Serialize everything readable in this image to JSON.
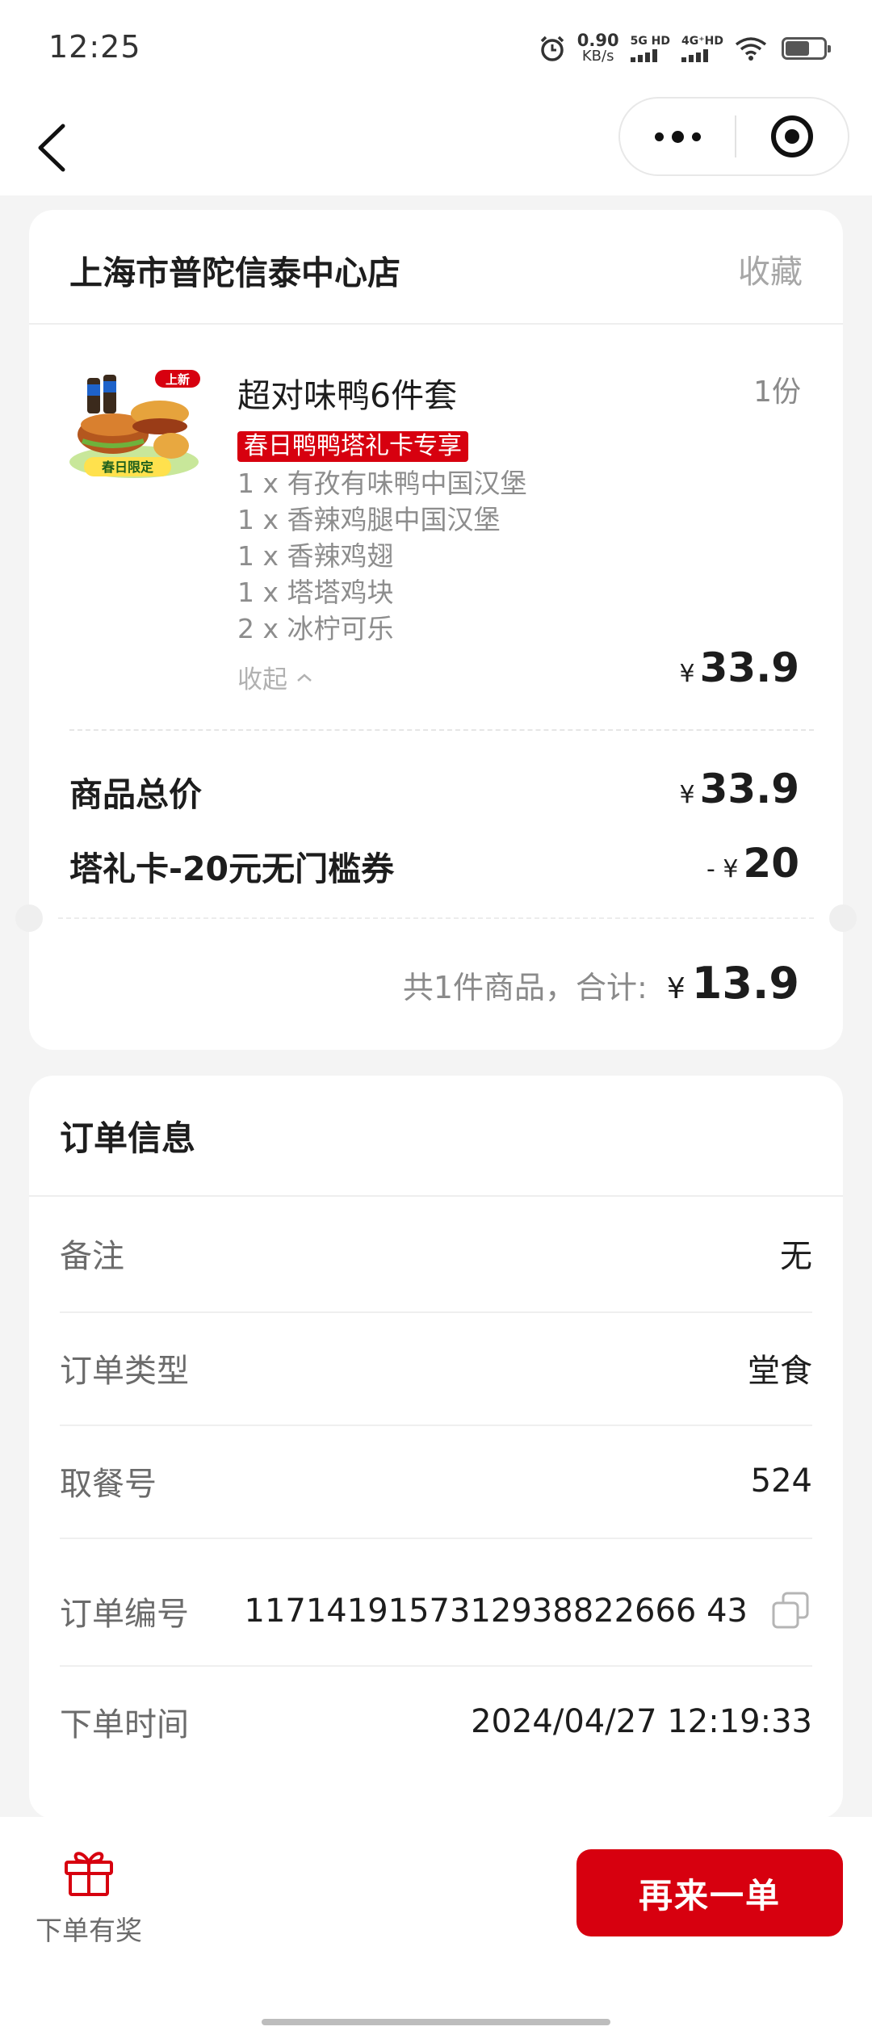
{
  "status_bar": {
    "time": "12:25",
    "net_speed_value": "0.90",
    "net_speed_unit": "KB/s",
    "sim1": "5G HD",
    "sim2": "4G⁺HD",
    "icons": [
      "alarm-icon",
      "signal-icon",
      "wifi-icon",
      "battery-icon"
    ]
  },
  "nav": {
    "back_icon": "chevron-left-icon",
    "more_icon": "more-dots-icon",
    "close_icon": "target-icon"
  },
  "order": {
    "store_name": "上海市普陀信泰中心店",
    "favorite_label": "收藏",
    "item": {
      "name": "超对味鸭6件套",
      "quantity": "1份",
      "promo_tag": "春日鸭鸭塔礼卡专享",
      "sub_items": [
        "1 x 有孜有味鸭中国汉堡",
        "1 x 香辣鸡腿中国汉堡",
        "1 x 香辣鸡翅",
        "1 x 塔塔鸡块",
        "2 x 冰柠可乐"
      ],
      "collapse_label": "收起",
      "price_currency": "¥",
      "price": "33.9",
      "thumb_badge_new": "上新",
      "thumb_badge_limited": "春日限定"
    },
    "goods_total_label": "商品总价",
    "goods_total_currency": "¥",
    "goods_total": "33.9",
    "coupon_label": "塔礼卡-20元无门槛券",
    "coupon_prefix": "- ¥",
    "coupon_value": "20",
    "total_label": "共1件商品，合计:",
    "total_currency": "¥",
    "total_value": "13.9"
  },
  "order_info": {
    "title": "订单信息",
    "rows": [
      {
        "key": "备注",
        "value": "无"
      },
      {
        "key": "订单类型",
        "value": "堂食"
      },
      {
        "key": "取餐号",
        "value": "524"
      },
      {
        "key": "订单编号",
        "value": "1171419157312938822666 43"
      },
      {
        "key": "下单时间",
        "value": "2024/04/27 12:19:33"
      }
    ]
  },
  "bottom": {
    "gift_label": "下单有奖",
    "reorder_label": "再来一单"
  },
  "colors": {
    "brand_red": "#d7000f",
    "background": "#f4f4f4"
  }
}
